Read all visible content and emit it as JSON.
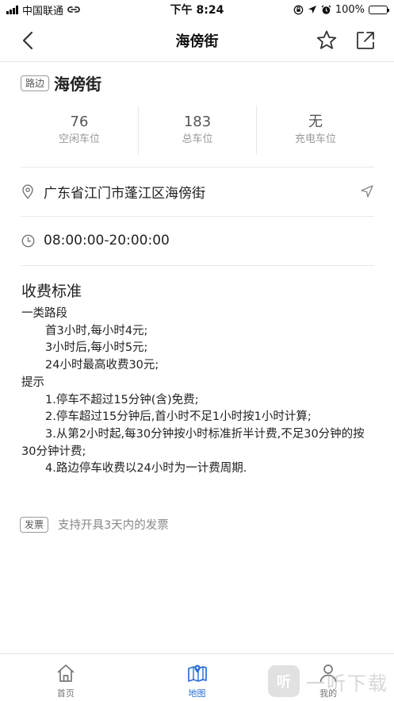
{
  "status_bar": {
    "carrier": "中国联通",
    "time": "下午 8:24",
    "battery": "100%"
  },
  "nav": {
    "title": "海傍街"
  },
  "parking": {
    "tag": "路边",
    "name": "海傍街",
    "stats": [
      {
        "value": "76",
        "label": "空闲车位"
      },
      {
        "value": "183",
        "label": "总车位"
      },
      {
        "value": "无",
        "label": "充电车位"
      }
    ],
    "address": "广东省江门市蓬江区海傍街",
    "hours": "08:00:00-20:00:00"
  },
  "fees": {
    "title": "收费标准",
    "lines": [
      "一类路段",
      "首3小时,每小时4元;",
      "3小时后,每小时5元;",
      "24小时最高收费30元;",
      "提示",
      "1.停车不超过15分钟(含)免费;",
      "2.停车超过15分钟后,首小时不足1小时按1小时计算;",
      "3.从第2小时起,每30分钟按小时标准折半计费,不足30分钟的按30分钟计费;",
      "4.路边停车收费以24小时为一计费周期."
    ]
  },
  "invoice": {
    "tag": "发票",
    "text": "支持开具3天内的发票"
  },
  "tabs": [
    {
      "label": "首页",
      "icon": "home-icon"
    },
    {
      "label": "地图",
      "icon": "map-icon"
    },
    {
      "label": "我的",
      "icon": "user-icon"
    }
  ],
  "watermark": {
    "badge": "听",
    "text": "一听下载"
  },
  "colors": {
    "accent": "#2a6fd6",
    "battery": "#4cd964"
  }
}
